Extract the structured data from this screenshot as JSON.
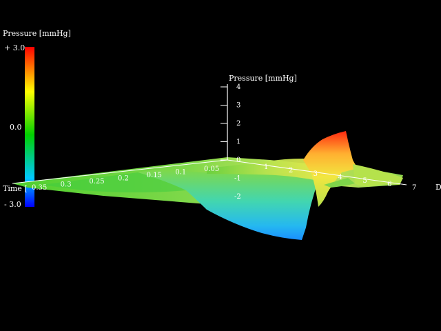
{
  "chart_data": {
    "type": "surface-3d",
    "colorbar": {
      "title": "Pressure [mmHg]",
      "max_label": "+ 3.0",
      "mid_label": "0.0",
      "min_label": "- 3.0",
      "range": [
        -3.0,
        3.0
      ],
      "colormap": [
        "#0000ff",
        "#00c8ff",
        "#00e000",
        "#ffff00",
        "#ff8000",
        "#ff0000"
      ]
    },
    "axes": {
      "z": {
        "label": "Pressure [mmHg]",
        "ticks": [
          "4",
          "3",
          "2",
          "1",
          "0",
          "-1",
          "-2"
        ],
        "range": [
          -2,
          4
        ]
      },
      "time": {
        "label": "Time [",
        "ticks": [
          "0.35",
          "0.3",
          "0.25",
          "0.2",
          "0.15",
          "0.1",
          "0.05"
        ]
      },
      "distance": {
        "label": "D",
        "ticks": [
          "1",
          "2",
          "3",
          "4",
          "5",
          "6",
          "7"
        ]
      }
    },
    "surface_profile": {
      "distance": [
        0,
        0.5,
        1,
        1.5,
        2,
        2.5,
        3,
        3.5,
        4,
        4.5,
        5,
        5.5,
        6,
        6.5,
        7
      ],
      "peak_pressure": [
        0.2,
        0.3,
        0.5,
        0.7,
        0.9,
        1.2,
        1.8,
        2.6,
        2.9,
        0.4,
        0.1,
        0.2,
        0.3,
        0.1,
        0.0
      ],
      "trough_pressure": [
        0.0,
        -0.3,
        -0.9,
        -1.6,
        -2.0,
        -2.3,
        -2.6,
        -2.8,
        -1.2,
        -0.4,
        -0.2,
        0.0,
        0.0,
        0.0,
        0.0
      ]
    }
  }
}
